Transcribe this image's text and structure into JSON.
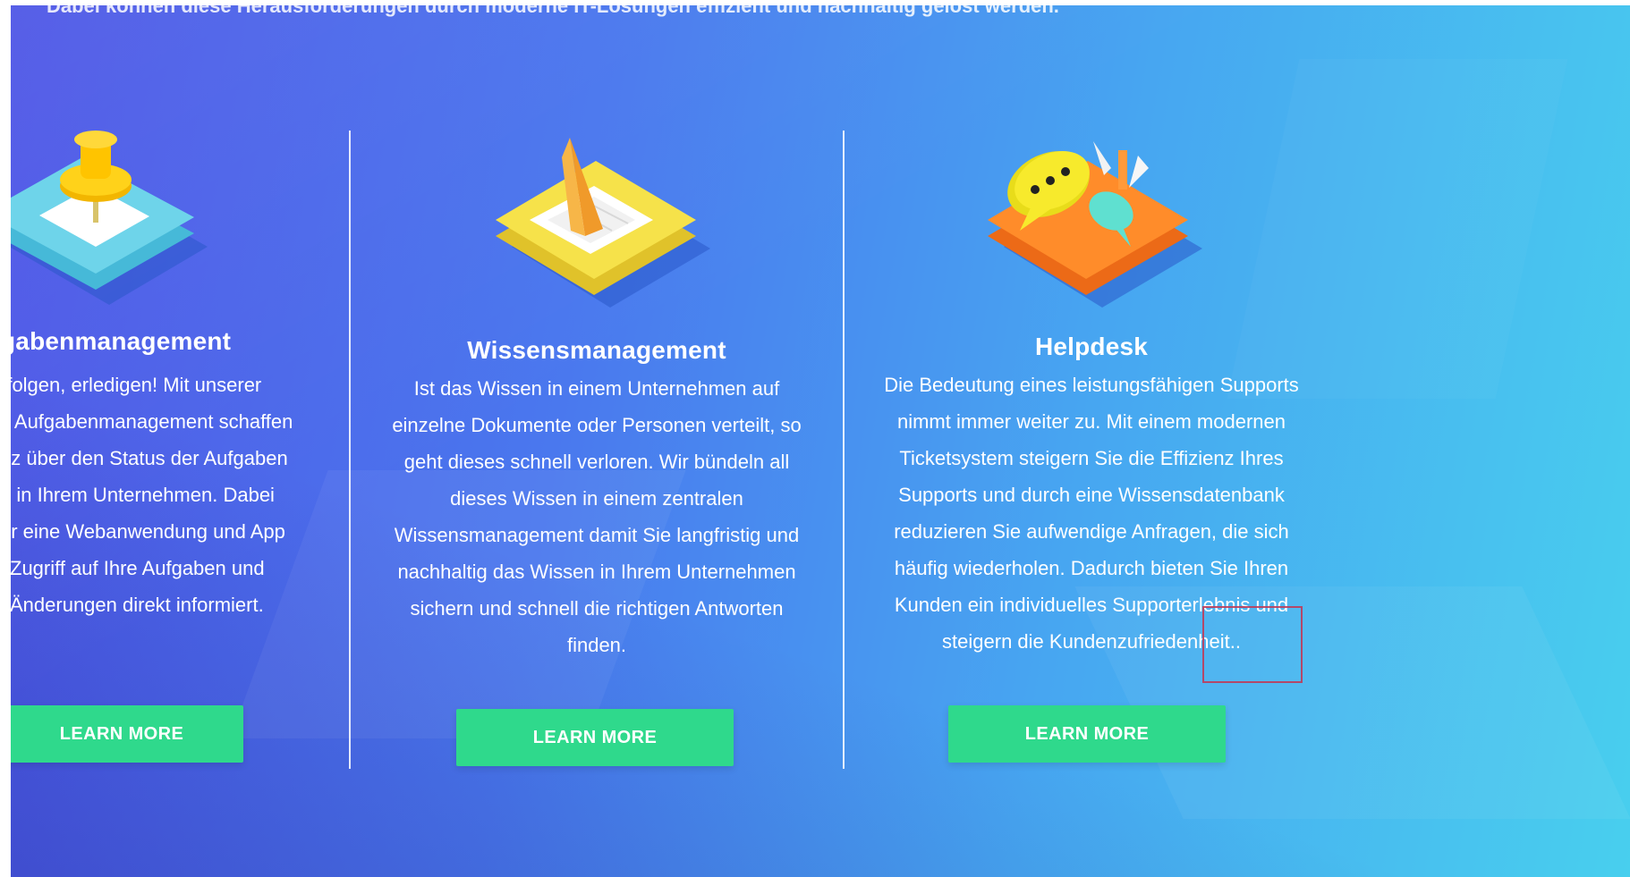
{
  "top_text": "Dabei können diese Herausforderungen durch moderne IT-Lösungen effizient und nachhaltig gelöst werden.",
  "features": [
    {
      "title": "gabenmanagement",
      "lines": [
        "rfolgen, erledigen! Mit unserer",
        "s Aufgabenmanagement schaffen",
        "nz über den Status der Aufgaben",
        "e in Ihrem Unternehmen. Dabei",
        "er eine Webanwendung und App",
        "l Zugriff auf Ihre Aufgaben und",
        "i Änderungen direkt informiert."
      ],
      "button": "LEARN MORE",
      "icon": "pushpin-icon"
    },
    {
      "title": "Wissensmanagement",
      "lines": [
        "Ist das Wissen in einem Unternehmen auf",
        "einzelne Dokumente oder Personen verteilt, so",
        "geht dieses schnell verloren. Wir bündeln all",
        "dieses Wissen in einem zentralen",
        "Wissensmanagement damit Sie langfristig und",
        "nachhaltig das Wissen in Ihrem Unternehmen",
        "sichern und schnell die richtigen Antworten",
        "finden."
      ],
      "button": "LEARN MORE",
      "icon": "ruler-triangle-icon"
    },
    {
      "title": "Helpdesk",
      "lines": [
        "Die Bedeutung eines leistungsfähigen Supports",
        "nimmt immer weiter zu. Mit einem modernen",
        "Ticketsystem steigern Sie die Effizienz Ihres",
        "Supports und durch eine Wissensdatenbank",
        "reduzieren Sie aufwendige Anfragen, die sich",
        "häufig wiederholen. Dadurch bieten Sie Ihren",
        "Kunden ein individuelles Supporterlebnis und",
        "steigern die Kundenzufriedenheit.."
      ],
      "button": "LEARN MORE",
      "icon": "chat-bubbles-icon"
    }
  ],
  "colors": {
    "button": "#2fd98c",
    "gradient_start": "#4d55e6",
    "gradient_end": "#48cfee"
  }
}
